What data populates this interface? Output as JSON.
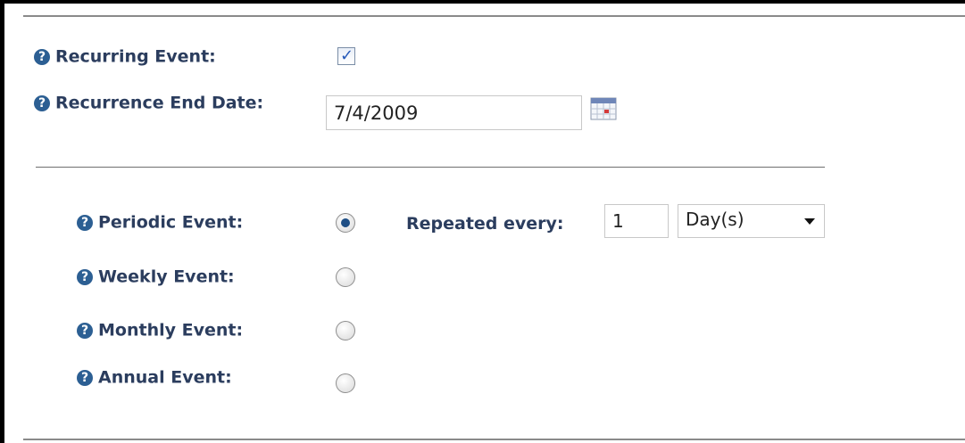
{
  "recurring": {
    "label": "Recurring Event:",
    "checked": true,
    "check_glyph": "✓"
  },
  "end_date": {
    "label": "Recurrence End Date:",
    "value": "7/4/2009",
    "calendar_icon": "calendar-icon"
  },
  "help_icon_glyph": "?",
  "events": [
    {
      "label": "Periodic Event:",
      "checked": true
    },
    {
      "label": "Weekly Event:",
      "checked": false
    },
    {
      "label": "Monthly Event:",
      "checked": false
    },
    {
      "label": "Annual Event:",
      "checked": false
    }
  ],
  "repeat": {
    "label": "Repeated every:",
    "value": "1",
    "unit": "Day(s)"
  },
  "colors": {
    "label": "#2b3d5e",
    "help_icon": "#2c5f93",
    "radio_dot": "#1f4f86"
  }
}
